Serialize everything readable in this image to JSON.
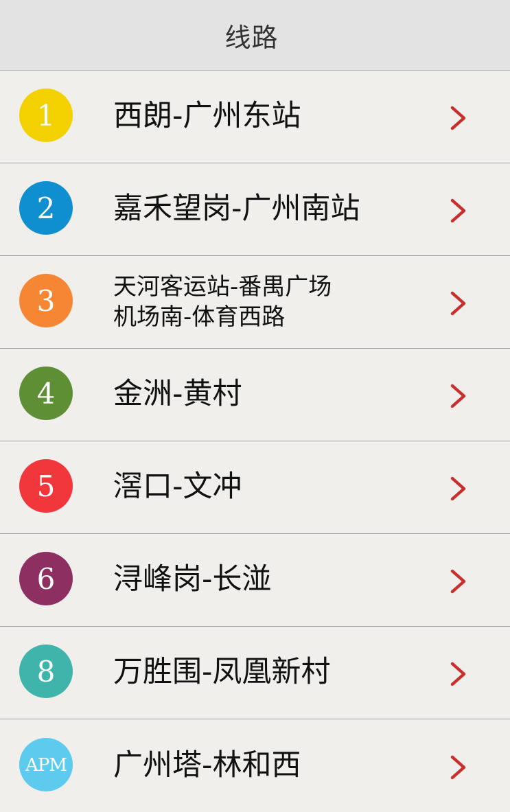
{
  "header": {
    "title": "线路"
  },
  "colors": {
    "chevron": "#c8302e",
    "line1": "#f3d000",
    "line2": "#0f8fcf",
    "line3": "#f58634",
    "line4": "#5f8f35",
    "line5": "#f2373c",
    "line6": "#8d2f60",
    "line8": "#3eb4ab",
    "apm": "#5ccbee"
  },
  "lines": [
    {
      "badge": "1",
      "color": "#f3d000",
      "title": "西朗-广州东站"
    },
    {
      "badge": "2",
      "color": "#0f8fcf",
      "title": "嘉禾望岗-广州南站"
    },
    {
      "badge": "3",
      "color": "#f58634",
      "title_line_1": "天河客运站-番禺广场",
      "title_line_2": "机场南-体育西路"
    },
    {
      "badge": "4",
      "color": "#5f8f35",
      "title": "金洲-黄村"
    },
    {
      "badge": "5",
      "color": "#f2373c",
      "title": "滘口-文冲"
    },
    {
      "badge": "6",
      "color": "#8d2f60",
      "title": "浔峰岗-长湴"
    },
    {
      "badge": "8",
      "color": "#3eb4ab",
      "title": "万胜围-凤凰新村"
    },
    {
      "badge": "APM",
      "color": "#5ccbee",
      "title": "广州塔-林和西"
    }
  ],
  "icons": {
    "row_action": "chevron-right-icon"
  }
}
